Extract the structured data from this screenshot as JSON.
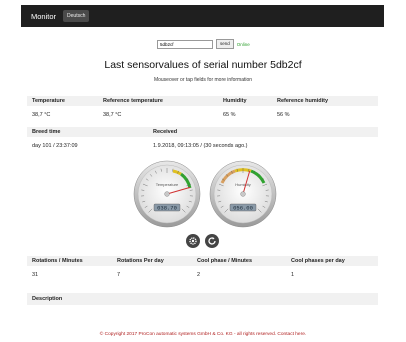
{
  "nav": {
    "brand": "Monitor",
    "lang_button": "Deutsch"
  },
  "search": {
    "value": "5db2cf",
    "button": "send",
    "status": "Online"
  },
  "page": {
    "title": "Last sensorvalues of serial number 5db2cf",
    "subtitle": "Mouseover or tap fields for more information"
  },
  "table1": {
    "headers": [
      "Temperature",
      "Reference temperature",
      "Humidity",
      "Reference humidity"
    ],
    "values": [
      "38,7 °C",
      "38,7 °C",
      "65 %",
      "56 %"
    ]
  },
  "table2": {
    "headers": [
      "Breed time",
      "Received"
    ],
    "values": [
      "day 101  /  23:37:09",
      "1.9.2018, 09:13:05 / (30 seconds ago.)"
    ]
  },
  "gauges": [
    {
      "label": "Temperature",
      "value": 38.7,
      "display": "038.70"
    },
    {
      "label": "Humidity",
      "value": 56,
      "display": "056.00"
    }
  ],
  "icons": [
    "gear-icon",
    "refresh-icon"
  ],
  "table3": {
    "headers": [
      "Rotations / Minutes",
      "Rotations Per day",
      "Cool phase / Minutes",
      "Cool phases per day"
    ],
    "values": [
      "31",
      "7",
      "2",
      "1"
    ]
  },
  "description": {
    "header": "Description"
  },
  "footer": {
    "text": "© Copyright 2017 ProCon automatic systems GmbH & Co. KG - all rights reserved. Contact here."
  },
  "colors": {
    "topbar": "#1f1f1f",
    "online": "#2a9d2a",
    "footer": "#b02020"
  }
}
